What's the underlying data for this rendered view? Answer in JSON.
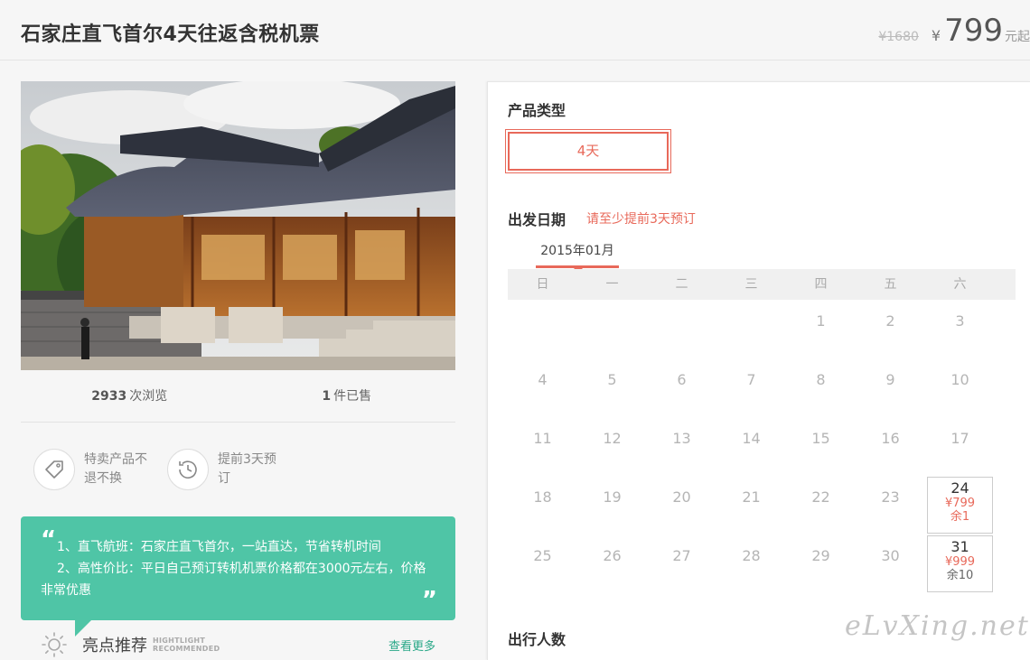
{
  "header": {
    "title": "石家庄直飞首尔4天往返含税机票",
    "old_price": "¥1680",
    "currency": "¥",
    "price": "799",
    "price_suffix": "元起"
  },
  "stats": {
    "views_count": "2933",
    "views_label": "次浏览",
    "sold_count": "1",
    "sold_label": "件已售"
  },
  "features": [
    {
      "icon": "tag-icon",
      "text": "特卖产品不退不换"
    },
    {
      "icon": "clock-history-icon",
      "text": "提前3天预订"
    }
  ],
  "bubble": {
    "line1": "1、直飞航班：石家庄直飞首尔，一站直达，节省转机时间",
    "line2": "2、高性价比：平日自己预订转机机票价格都在3000元左右，价格",
    "line3": "非常优惠"
  },
  "highlight": {
    "icon": "sun-icon",
    "title": "亮点推荐",
    "en_line1": "HIGHTLIGHT",
    "en_line2": "RECOMMENDED",
    "more": "查看更多"
  },
  "booking": {
    "type_label": "产品类型",
    "type_option": "4天",
    "date_label": "出发日期",
    "date_note": "请至少提前3天预订",
    "month": "2015年01月",
    "weekdays": [
      "日",
      "一",
      "二",
      "三",
      "四",
      "五",
      "六"
    ],
    "travelers_label": "出行人数"
  },
  "calendar": {
    "rows": [
      [
        "",
        "",
        "",
        "",
        "1",
        "2",
        "3"
      ],
      [
        "4",
        "5",
        "6",
        "7",
        "8",
        "9",
        "10"
      ],
      [
        "11",
        "12",
        "13",
        "14",
        "15",
        "16",
        "17"
      ],
      [
        "18",
        "19",
        "20",
        "21",
        "22",
        "23",
        "24"
      ],
      [
        "25",
        "26",
        "27",
        "28",
        "29",
        "30",
        "31"
      ]
    ],
    "available": {
      "24": {
        "price": "¥799",
        "remain": "余1",
        "remain_dark": false
      },
      "31": {
        "price": "¥999",
        "remain": "余10",
        "remain_dark": true
      }
    }
  },
  "watermark": "eLvXing.net",
  "colors": {
    "accent": "#e8695a",
    "teal": "#4fc5a6",
    "link": "#2aa888"
  }
}
